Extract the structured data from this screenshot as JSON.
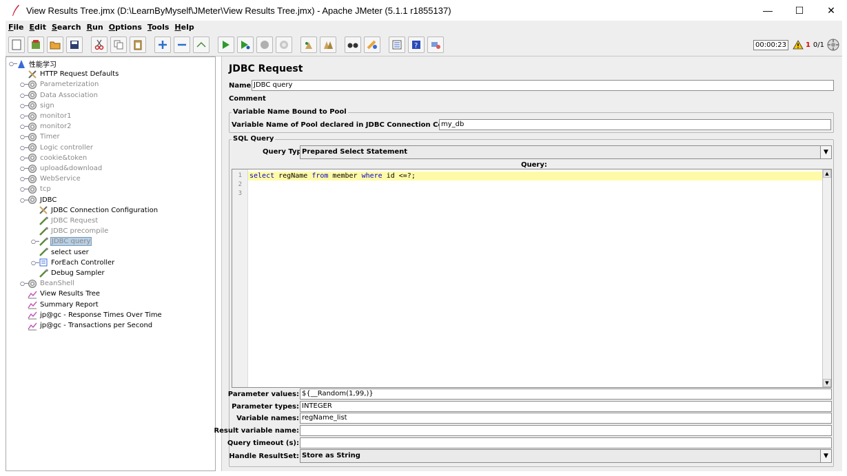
{
  "window": {
    "title": "View Results Tree.jmx (D:\\LearnByMyself\\JMeter\\View Results Tree.jmx) - Apache JMeter (5.1.1 r1855137)",
    "minimize": "—",
    "maximize": "☐",
    "close": "✕"
  },
  "menu": [
    {
      "key": "F",
      "rest": "ile"
    },
    {
      "key": "E",
      "rest": "dit"
    },
    {
      "key": "S",
      "rest": "earch"
    },
    {
      "key": "R",
      "rest": "un"
    },
    {
      "key": "O",
      "rest": "ptions"
    },
    {
      "key": "T",
      "rest": "ools"
    },
    {
      "key": "H",
      "rest": "elp"
    }
  ],
  "toolbar": {
    "timer": "00:00:23",
    "warnings": "1",
    "threads": "0/1"
  },
  "tree": [
    {
      "label": "性能学习",
      "icon": "testplan-icon",
      "level": 0,
      "handle": "○─",
      "state": "normal"
    },
    {
      "label": "HTTP Request Defaults",
      "icon": "config-icon",
      "level": 1,
      "handle": "",
      "state": "normal"
    },
    {
      "label": "Parameterization",
      "icon": "threadgroup-icon",
      "level": 1,
      "handle": "○─",
      "state": "disabled"
    },
    {
      "label": "Data Association",
      "icon": "threadgroup-icon",
      "level": 1,
      "handle": "○─",
      "state": "disabled"
    },
    {
      "label": "sign",
      "icon": "threadgroup-icon",
      "level": 1,
      "handle": "○─",
      "state": "disabled"
    },
    {
      "label": "monitor1",
      "icon": "threadgroup-icon",
      "level": 1,
      "handle": "○─",
      "state": "disabled"
    },
    {
      "label": "monitor2",
      "icon": "threadgroup-icon",
      "level": 1,
      "handle": "○─",
      "state": "disabled"
    },
    {
      "label": "Timer",
      "icon": "threadgroup-icon",
      "level": 1,
      "handle": "○─",
      "state": "disabled"
    },
    {
      "label": "Logic controller",
      "icon": "threadgroup-icon",
      "level": 1,
      "handle": "○─",
      "state": "disabled"
    },
    {
      "label": "cookie&token",
      "icon": "threadgroup-icon",
      "level": 1,
      "handle": "○─",
      "state": "disabled"
    },
    {
      "label": "upload&download",
      "icon": "threadgroup-icon",
      "level": 1,
      "handle": "○─",
      "state": "disabled"
    },
    {
      "label": "WebService",
      "icon": "threadgroup-icon",
      "level": 1,
      "handle": "○─",
      "state": "disabled"
    },
    {
      "label": "tcp",
      "icon": "threadgroup-icon",
      "level": 1,
      "handle": "○─",
      "state": "disabled"
    },
    {
      "label": "JDBC",
      "icon": "threadgroup-icon",
      "level": 1,
      "handle": "○─",
      "state": "normal"
    },
    {
      "label": "JDBC Connection Configuration",
      "icon": "config-icon",
      "level": 2,
      "handle": "",
      "state": "normal"
    },
    {
      "label": "JDBC Request",
      "icon": "sampler-icon",
      "level": 2,
      "handle": "",
      "state": "disabled"
    },
    {
      "label": "JDBC precompile",
      "icon": "sampler-icon",
      "level": 2,
      "handle": "",
      "state": "disabled"
    },
    {
      "label": "JDBC query",
      "icon": "sampler-icon",
      "level": 2,
      "handle": "○─",
      "state": "selected"
    },
    {
      "label": "select user",
      "icon": "sampler-icon",
      "level": 2,
      "handle": "",
      "state": "normal"
    },
    {
      "label": "ForEach Controller",
      "icon": "controller-icon",
      "level": 2,
      "handle": "○─",
      "state": "normal"
    },
    {
      "label": "Debug Sampler",
      "icon": "sampler-icon",
      "level": 2,
      "handle": "",
      "state": "normal"
    },
    {
      "label": "BeanShell",
      "icon": "threadgroup-icon",
      "level": 1,
      "handle": "○─",
      "state": "disabled"
    },
    {
      "label": "View Results Tree",
      "icon": "listener-icon",
      "level": 1,
      "handle": "",
      "state": "normal"
    },
    {
      "label": "Summary Report",
      "icon": "listener-icon",
      "level": 1,
      "handle": "",
      "state": "normal"
    },
    {
      "label": "jp@gc - Response Times Over Time",
      "icon": "listener-icon",
      "level": 1,
      "handle": "",
      "state": "normal"
    },
    {
      "label": "jp@gc - Transactions per Second",
      "icon": "listener-icon",
      "level": 1,
      "handle": "",
      "state": "normal"
    }
  ],
  "panel": {
    "heading": "JDBC Request",
    "name_label": "Name:",
    "name_value": "JDBC query",
    "comments_label": "Comments:",
    "comments_value": "",
    "pool_group_title": "Variable Name Bound to Pool",
    "pool_label": "Variable Name of Pool declared in JDBC Connection Configuration:",
    "pool_value": "my_db",
    "sql_group_title": "SQL Query",
    "query_type_label": "Query Type:",
    "query_type_value": "Prepared Select Statement",
    "query_label": "Query:",
    "line_numbers": [
      "1",
      "2",
      "3"
    ],
    "code": [
      {
        "t": "select",
        "kw": true
      },
      {
        "t": " regName ",
        "kw": false
      },
      {
        "t": "from",
        "kw": true
      },
      {
        "t": " member ",
        "kw": false
      },
      {
        "t": "where",
        "kw": true
      },
      {
        "t": " id <=?;",
        "kw": false
      }
    ],
    "param_values_label": "Parameter values:",
    "param_values": "${__Random(1,99,)}",
    "param_types_label": "Parameter types:",
    "param_types": "INTEGER",
    "var_names_label": "Variable names:",
    "var_names": "regName_list",
    "result_var_label": "Result variable name:",
    "result_var": "",
    "timeout_label": "Query timeout (s):",
    "timeout": "",
    "handle_label": "Handle ResultSet:",
    "handle_value": "Store as String"
  },
  "colors": {
    "selection": "#b8cfe5",
    "current_line": "#fffaa8",
    "keyword": "#0000cc",
    "disabled_text": "#8a8a8a"
  }
}
